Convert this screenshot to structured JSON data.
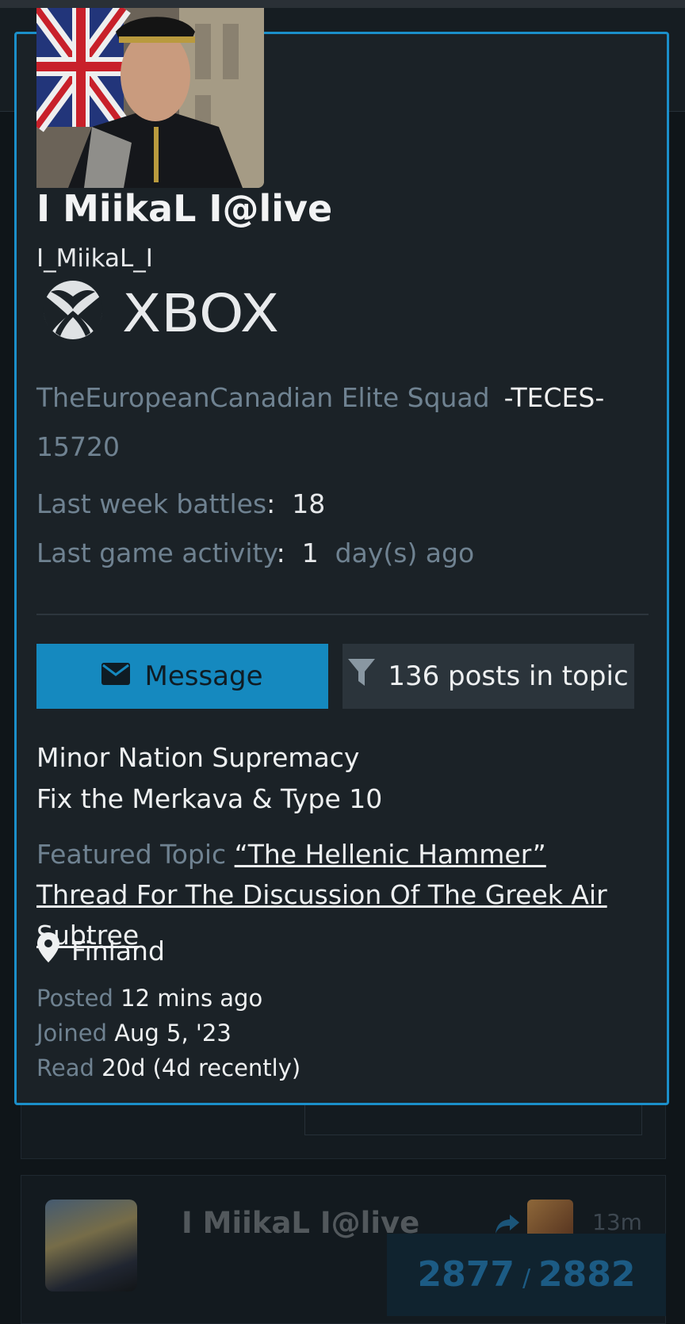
{
  "profile": {
    "display_name": "I MiikaL I@live",
    "username": "I_MiikaL_I",
    "platform_logo": "XBOX",
    "squad_name": "TheEuropeanCanadian Elite Squad",
    "squad_tag": "-TECES-",
    "rating": "15720",
    "last_week_battles_label": "Last week battles",
    "last_week_battles_value": "18",
    "last_activity_label": "Last game activity",
    "last_activity_value": "1",
    "last_activity_unit": "day(s) ago"
  },
  "actions": {
    "message_label": "Message",
    "posts_label": "136 posts in topic"
  },
  "signature": {
    "line1": "Minor Nation Supremacy",
    "line2": "Fix the Merkava & Type 10"
  },
  "featured": {
    "label": "Featured Topic",
    "title": "“The Hellenic Hammer” Thread For The Discussion Of The Greek Air Subtree"
  },
  "location": "Finland",
  "stats": {
    "posted_label": "Posted",
    "posted_value": "12 mins ago",
    "joined_label": "Joined",
    "joined_value": "Aug 5, '23",
    "read_label": "Read",
    "read_value": "20d (4d recently)"
  },
  "background_post": {
    "author": "I MiikaL I@live",
    "time": "13m"
  },
  "progress": {
    "current": "2877",
    "separator": "/",
    "total": "2882"
  },
  "colors": {
    "accent": "#1b8fca",
    "card_bg": "#1b2227",
    "muted_text": "#6f8291"
  },
  "icons": [
    "envelope-icon",
    "filter-icon",
    "map-pin-icon",
    "reply-icon",
    "xbox-logo"
  ]
}
